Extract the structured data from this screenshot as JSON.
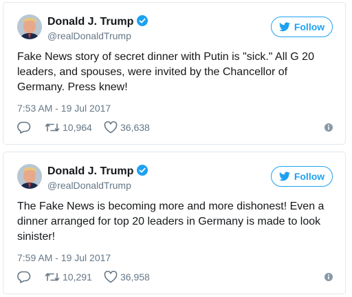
{
  "colors": {
    "accent": "#1da1f2",
    "secondary_text": "#657786",
    "border": "#e1e8ed"
  },
  "tweets": [
    {
      "name": "Donald J. Trump",
      "handle": "@realDonaldTrump",
      "follow_label": "Follow",
      "text": "Fake News story of secret dinner with Putin is \"sick.\" All G 20 leaders, and spouses, were invited by the Chancellor of Germany. Press knew!",
      "time": "7:53 AM - 19 Jul 2017",
      "retweets": "10,964",
      "likes": "36,638",
      "icons": [
        "reply-icon",
        "retweet-icon",
        "heart-icon",
        "info-icon",
        "verified-badge-icon",
        "twitter-bird-icon"
      ]
    },
    {
      "name": "Donald J. Trump",
      "handle": "@realDonaldTrump",
      "follow_label": "Follow",
      "text": "The Fake News is becoming more and more dishonest! Even a dinner arranged for top 20 leaders in Germany is made to look sinister!",
      "time": "7:59 AM - 19 Jul 2017",
      "retweets": "10,291",
      "likes": "36,958",
      "icons": [
        "reply-icon",
        "retweet-icon",
        "heart-icon",
        "info-icon",
        "verified-badge-icon",
        "twitter-bird-icon"
      ]
    }
  ]
}
